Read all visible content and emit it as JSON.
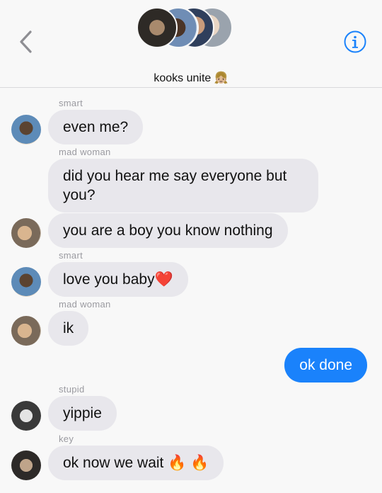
{
  "header": {
    "group_name": "kooks unite 👧🏼",
    "back_icon": "chevron-left-icon",
    "info_icon": "info-circle-icon",
    "accent_color": "#1a82fb"
  },
  "messages": [
    {
      "sender": "smart",
      "text": "even me?",
      "outgoing": false
    },
    {
      "sender": "mad woman",
      "text": "did you hear me say everyone but you?",
      "outgoing": false
    },
    {
      "sender": "",
      "text": "you are a boy you know nothing",
      "outgoing": false
    },
    {
      "sender": "smart",
      "text": "love you baby❤️",
      "outgoing": false
    },
    {
      "sender": "mad woman",
      "text": "ik",
      "outgoing": false
    },
    {
      "sender": "",
      "text": "ok done",
      "outgoing": true
    },
    {
      "sender": "stupid",
      "text": "yippie",
      "outgoing": false
    },
    {
      "sender": "key",
      "text": "ok now we wait 🔥 🔥",
      "outgoing": false
    }
  ]
}
